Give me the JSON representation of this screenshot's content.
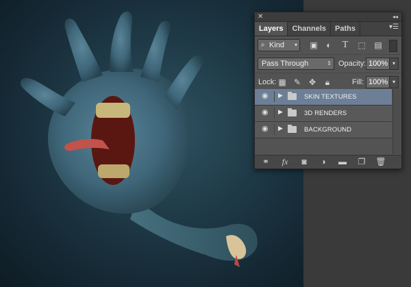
{
  "panel": {
    "tabs": [
      {
        "label": "Layers",
        "active": true
      },
      {
        "label": "Channels",
        "active": false
      },
      {
        "label": "Paths",
        "active": false
      }
    ],
    "filter": {
      "label": "Kind"
    },
    "blend_mode": "Pass Through",
    "opacity_label": "Opacity:",
    "opacity_value": "100%",
    "lock_label": "Lock:",
    "fill_label": "Fill:",
    "fill_value": "100%",
    "layers": [
      {
        "name": "SKIN TEXTURES",
        "type": "group",
        "visible": true,
        "selected": true
      },
      {
        "name": "3D RENDERS",
        "type": "group",
        "visible": true,
        "selected": false
      },
      {
        "name": "BACKGROUND",
        "type": "group",
        "visible": true,
        "selected": false
      }
    ],
    "filter_icons": [
      "image-filter-icon",
      "adjustment-filter-icon",
      "type-filter-icon",
      "shape-filter-icon",
      "smart-object-filter-icon"
    ],
    "lock_icons": [
      "lock-transparent-icon",
      "lock-paint-icon",
      "lock-move-icon",
      "lock-all-icon"
    ],
    "bottom_icons": [
      "link-icon",
      "fx-icon",
      "mask-icon",
      "adjustment-icon",
      "new-group-icon",
      "new-layer-icon",
      "trash-icon"
    ]
  },
  "colors": {
    "canvas_background": "#1f3a47",
    "panel_background": "#535353",
    "selected_layer": "#6d7f96",
    "hand_skin": "#3e6578"
  }
}
